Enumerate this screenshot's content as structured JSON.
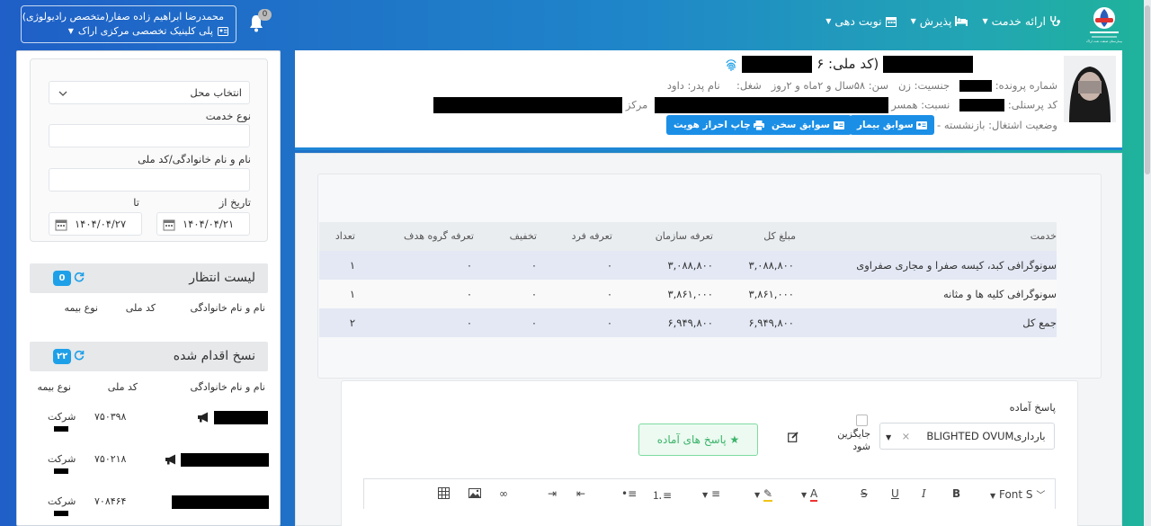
{
  "header": {
    "user_name": "محمدرضا ابراهیم زاده صفار(متخصص رادیولوژی)",
    "clinic": "پلی کلینیک تخصصی مرکزی اراک",
    "notification_count": "0",
    "nav": [
      {
        "label": "ارائه خدمت",
        "icon": "stethoscope-icon"
      },
      {
        "label": "پذیرش",
        "icon": "bed-icon"
      },
      {
        "label": "نوبت دهی",
        "icon": "calendar-icon"
      }
    ],
    "logo_caption": "بیمارستان صنعت نفت اراک"
  },
  "filters": {
    "location_placeholder": "انتخاب محل",
    "service_type_label": "نوع خدمت",
    "name_label": "نام و نام خانوادگی/کد ملی",
    "date_from_label": "تاریخ از",
    "date_to_label": "تا",
    "date_from": "۱۴۰۴/۰۴/۲۱",
    "date_to": "۱۴۰۴/۰۴/۲۷"
  },
  "waiting": {
    "title": "لیست انتظار",
    "count": "0",
    "columns": [
      "نام و نام خانوادگی",
      "کد ملی",
      "نوع بیمه"
    ]
  },
  "done": {
    "title": "نسخ اقدام شده",
    "count": "۲۲",
    "columns": [
      "نام و نام خانوادگی",
      "کد ملی",
      "نوع بیمه"
    ],
    "rows": [
      {
        "code": "۷۵۰۳۹۸",
        "insurance": "شرکت"
      },
      {
        "code": "۷۵۰۲۱۸",
        "insurance": "شرکت"
      },
      {
        "code": "۷۰۸۴۶۴",
        "insurance": "شرکت"
      }
    ]
  },
  "patient": {
    "national_code_prefix": "(کد ملی: ۶",
    "file_number_label": "شماره پرونده:",
    "gender": "جنسیت: زن",
    "age": "سن: ۵۸سال و ۲ماه و ۲روز",
    "job": "شغل:",
    "father": "نام پدر: داود",
    "personnel_label": "کد پرسنلی:",
    "relation": "نسبت: همسر",
    "center_label": "مرکز",
    "employment": "وضعیت اشتغال: بازنشسته -",
    "btn_history": "سوابق بیمار",
    "btn_speech": "سوابق سخن",
    "btn_print": "چاپ احراز هویت"
  },
  "services_table": {
    "headers": [
      "خدمت",
      "مبلغ کل",
      "تعرفه سازمان",
      "تعرفه فرد",
      "تخفیف",
      "تعرفه گروه هدف",
      "تعداد"
    ],
    "rows": [
      [
        "سونوگرافی کبد، کیسه صفرا و مجاری صفراوی",
        "۳,۰۸۸,۸۰۰",
        "۳,۰۸۸,۸۰۰",
        "۰",
        "۰",
        "۰",
        "۱"
      ],
      [
        "سونوگرافی کلیه ها و مثانه",
        "۳,۸۶۱,۰۰۰",
        "۳,۸۶۱,۰۰۰",
        "۰",
        "۰",
        "۰",
        "۱"
      ],
      [
        "جمع کل",
        "۶,۹۴۹,۸۰۰",
        "۶,۹۴۹,۸۰۰",
        "۰",
        "۰",
        "۰",
        "۲"
      ]
    ]
  },
  "answer": {
    "label": "پاسخ آماده",
    "selected": "BLIGHTED OVUMبارداری",
    "replace_label": "جایگزین شود",
    "ready_button": "پاسخ های آماده",
    "toolbar": {
      "font": "Font S",
      "bold": "B",
      "italic": "I",
      "underline": "U",
      "strike": "S"
    }
  }
}
